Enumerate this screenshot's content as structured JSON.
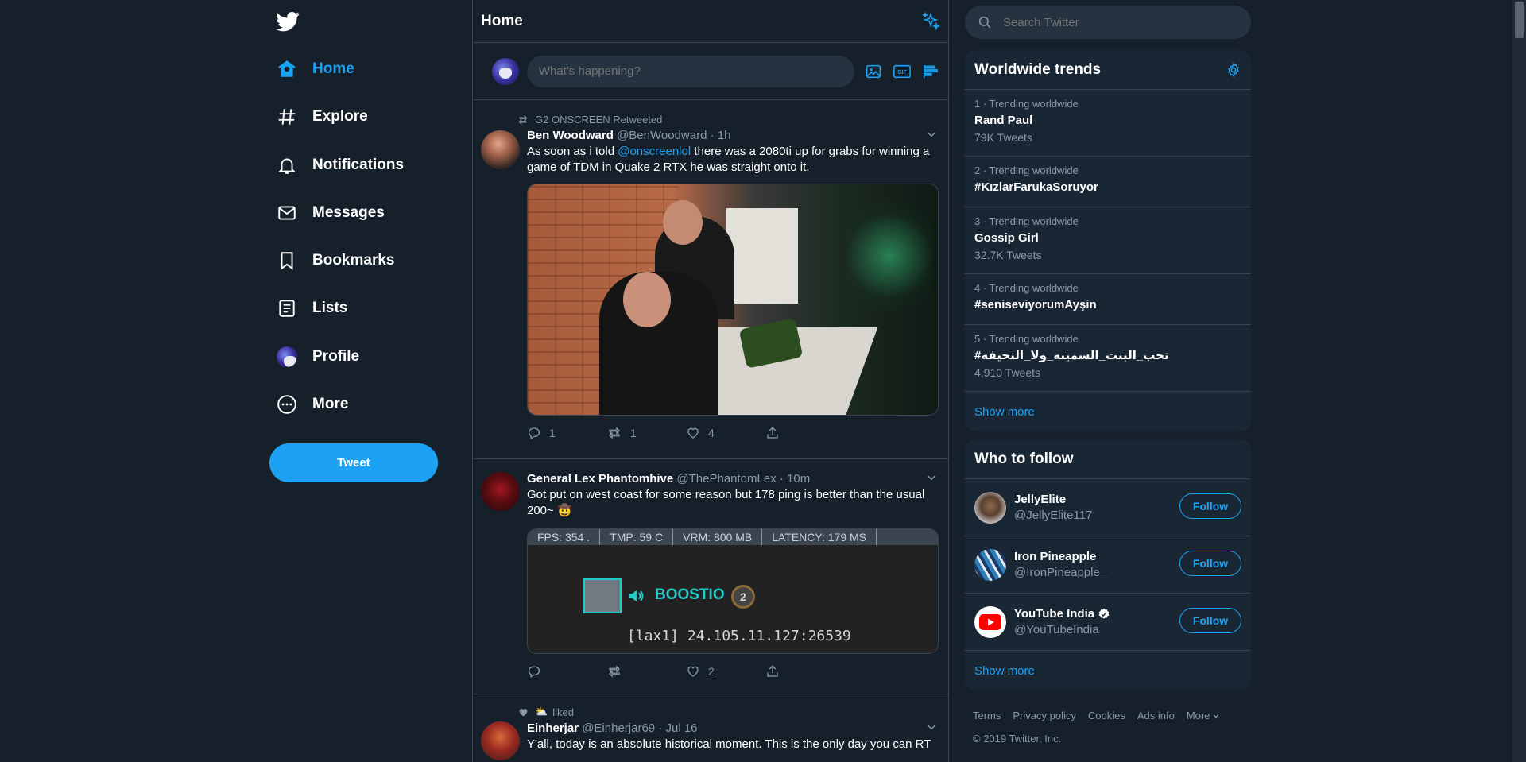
{
  "colors": {
    "background": "#15202b",
    "accent": "#1da1f2",
    "muted": "#8899a6",
    "panel": "#192734",
    "border": "#38444d"
  },
  "nav": {
    "items": [
      {
        "label": "Home",
        "icon": "home-icon",
        "active": true
      },
      {
        "label": "Explore",
        "icon": "hashtag-icon"
      },
      {
        "label": "Notifications",
        "icon": "bell-icon"
      },
      {
        "label": "Messages",
        "icon": "envelope-icon"
      },
      {
        "label": "Bookmarks",
        "icon": "bookmark-icon"
      },
      {
        "label": "Lists",
        "icon": "list-icon"
      },
      {
        "label": "Profile",
        "icon": "profile-avatar-icon"
      },
      {
        "label": "More",
        "icon": "more-circle-icon"
      }
    ],
    "tweet_button": "Tweet"
  },
  "header": {
    "title": "Home"
  },
  "composer": {
    "placeholder": "What's happening?"
  },
  "tweets": [
    {
      "social_context": "G2 ONSCREEN Retweeted",
      "name": "Ben Woodward",
      "handle": "@BenWoodward",
      "time": "· 1h",
      "text_before": "As soon as i told ",
      "mention": "@onscreenlol",
      "text_after": " there was a 2080ti up for grabs for winning a game of TDM in Quake 2 RTX he was straight onto it.",
      "replies": "1",
      "retweets": "1",
      "likes": "4"
    },
    {
      "name": "General Lex Phantomhive",
      "handle": "@ThePhantomLex",
      "time": "· 10m",
      "text": "Got put on west coast for some reason but 178 ping is better than the usual 200~ 🤠",
      "hud": {
        "fps": "FPS: 354 .",
        "tmp": "TMP: 59 C",
        "vrm": "VRM: 800 MB",
        "latency": "LATENCY: 179 MS",
        "player": "BOOSTIO",
        "rank": "2",
        "server": "[lax1] 24.105.11.127:26539"
      },
      "replies": "",
      "retweets": "",
      "likes": "2"
    },
    {
      "social_context": "liked",
      "name": "Einherjar",
      "handle": "@Einherjar69",
      "time": "· Jul 16",
      "text": "Y'all, today is an absolute historical moment. This is the only day you can RT"
    }
  ],
  "search": {
    "placeholder": "Search Twitter"
  },
  "trends": {
    "title": "Worldwide trends",
    "items": [
      {
        "meta": "1 · Trending worldwide",
        "name": "Rand Paul",
        "count": "79K Tweets"
      },
      {
        "meta": "2 · Trending worldwide",
        "name": "#KızlarFarukaSoruyor",
        "count": ""
      },
      {
        "meta": "3 · Trending worldwide",
        "name": "Gossip Girl",
        "count": "32.7K Tweets"
      },
      {
        "meta": "4 · Trending worldwide",
        "name": "#seniseviyorumAyşin",
        "count": ""
      },
      {
        "meta": "5 · Trending worldwide",
        "name": "#تحب_البنت_السمينه_ولا_النحيفه",
        "count": "4,910 Tweets"
      }
    ],
    "show_more": "Show more"
  },
  "who_to_follow": {
    "title": "Who to follow",
    "items": [
      {
        "name": "JellyElite",
        "handle": "@JellyElite117",
        "button": "Follow",
        "verified": false
      },
      {
        "name": "Iron Pineapple",
        "handle": "@IronPineapple_",
        "button": "Follow",
        "verified": false
      },
      {
        "name": "YouTube India",
        "handle": "@YouTubeIndia",
        "button": "Follow",
        "verified": true
      }
    ],
    "show_more": "Show more"
  },
  "footer": {
    "links": [
      "Terms",
      "Privacy policy",
      "Cookies",
      "Ads info",
      "More"
    ],
    "copyright": "© 2019 Twitter, Inc."
  }
}
